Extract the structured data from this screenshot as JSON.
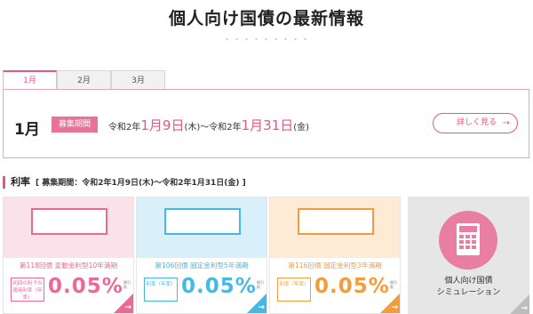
{
  "page": {
    "title": "個人向け国債の最新情報",
    "title_dots": "・・・・・・・・・"
  },
  "tabs": [
    {
      "label": "1月"
    },
    {
      "label": "2月"
    },
    {
      "label": "3月"
    }
  ],
  "period": {
    "month": "1月",
    "badge": "募集期間",
    "start_prefix": "令和2年",
    "start_date": "1月9日",
    "start_weekday": "(木)〜令和2年",
    "end_date": "1月31日",
    "end_weekday": "(金)",
    "detail_button": "詳しく見る",
    "detail_arrow": "→"
  },
  "rates": {
    "heading": "利率",
    "subheading": "[ 募集期間：令和2年1月9日(木)〜令和2年1月31日(金) ]"
  },
  "cards": [
    {
      "logo_chars": [
        "変",
        "動",
        "10"
      ],
      "name": "第118回債 変動金利型10年満期",
      "rate_label": "初回の利子の適用利率（年率）",
      "rate": "0.05%",
      "side_note": "税引前",
      "color": "#ea6a95",
      "bg": "#fbe2ea"
    },
    {
      "logo_chars": [
        "固",
        "定",
        "5"
      ],
      "name": "第106回債 固定金利型5年満期",
      "rate_label": "利率（年率）",
      "rate": "0.05%",
      "side_note": "税引前",
      "color": "#46b8e4",
      "bg": "#d9f0fa"
    },
    {
      "logo_chars": [
        "固",
        "定",
        "3"
      ],
      "name": "第116回債 固定金利型3年満期",
      "rate_label": "利率（年率）",
      "rate": "0.05%",
      "side_note": "税引前",
      "color": "#f29d3d",
      "bg": "#fdebd6"
    }
  ],
  "simulation": {
    "line1": "個人向け国債",
    "line2": "シミュレーション"
  },
  "icons": {
    "calculator": "calculator-icon",
    "arrow": "→"
  }
}
